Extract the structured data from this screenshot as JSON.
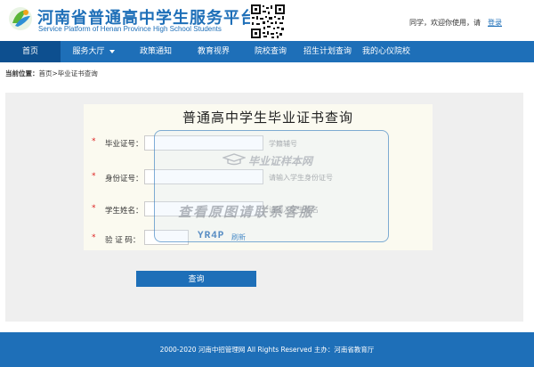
{
  "header": {
    "logo_title": "河南省普通高中学生服务平台",
    "logo_subtitle": "Service Platform of Henan Province High School Students",
    "welcome_text": "同学，欢迎你使用，请",
    "login_label": "登录"
  },
  "nav": {
    "items": [
      {
        "label": "首页",
        "active": true
      },
      {
        "label": "服务大厅",
        "dropdown": true
      },
      {
        "label": "政策通知"
      },
      {
        "label": "教育视界"
      },
      {
        "label": "院校查询"
      },
      {
        "label": "招生计划查询"
      },
      {
        "label": "我的心仪院校"
      }
    ]
  },
  "breadcrumb": {
    "prefix": "当前位置：",
    "home": "首页",
    "current": ">毕业证书查询"
  },
  "form": {
    "title": "普通高中学生毕业证书查询",
    "required_mark": "*",
    "fields": [
      {
        "label": "毕业证号：",
        "hint": "学籍辅号"
      },
      {
        "label": "身份证号：",
        "hint": "请输入学生身份证号"
      },
      {
        "label": "学生姓名：",
        "hint": "请输入学生姓名"
      },
      {
        "label": "验 证 码："
      }
    ],
    "captcha_text": "YR4P",
    "refresh_label": "刷新",
    "submit_label": "查询"
  },
  "watermark": {
    "brand": "毕业证样本网",
    "text": "查看原图请联系客服"
  },
  "footer": {
    "text": "2000-2020 河南中招管理网 All Rights Reserved 主办：河南省教育厅"
  },
  "colors": {
    "primary": "#1e6fb8",
    "nav_active": "#0d4f8f",
    "required": "#dd2222"
  }
}
